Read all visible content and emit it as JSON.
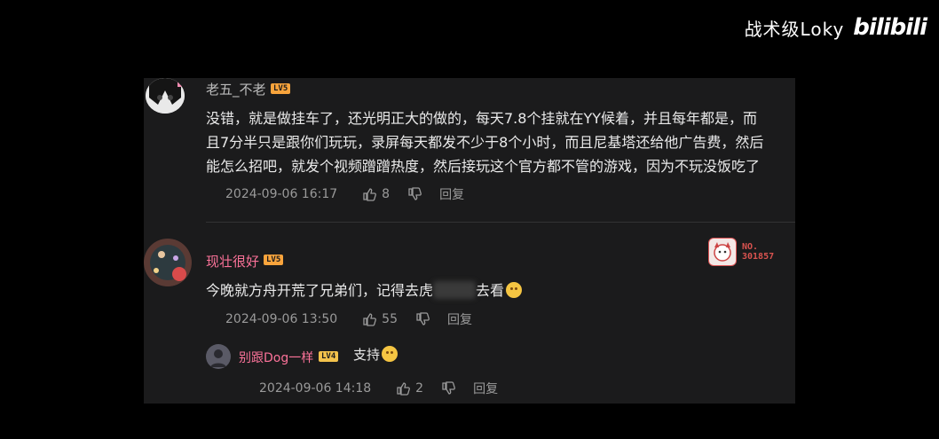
{
  "watermark": {
    "channel_name": "战术级Loky",
    "logo_text": "bilibili"
  },
  "comments": [
    {
      "username": "老五_不老",
      "level": "LV5",
      "lines": [
        "没错，就是做挂车了，还光明正大的做的，每天7.8个挂就在YY候着，并且每年都是，而",
        "且7分半只是跟你们玩玩，录屏每天都发不少于8个小时，而且尼基塔还给他广告费，然后",
        "能怎么招吧，就发个视频蹭蹭热度，然后接玩这个官方都不管的游戏，因为不玩没饭吃了"
      ],
      "time": "2024-09-06 16:17",
      "likes": "8",
      "reply_label": "回复"
    },
    {
      "username": "现壮很好",
      "level": "LV5",
      "text_before": "今晚就方舟开荒了兄弟们，记得去虎",
      "text_after": "去看",
      "time": "2024-09-06 13:50",
      "likes": "55",
      "reply_label": "回复",
      "fan_badge": {
        "no_label": "NO.",
        "number": "301857"
      }
    }
  ],
  "reply": {
    "username": "别跟Dog一样",
    "level": "LV4",
    "text": "支持",
    "time": "2024-09-06 14:18",
    "likes": "2",
    "reply_label": "回复"
  },
  "colors": {
    "username_pink": "#fb7299",
    "level_lv5": "#f9a43c",
    "level_lv4": "#f3c24c",
    "meta_gray": "#9a9a9a"
  }
}
